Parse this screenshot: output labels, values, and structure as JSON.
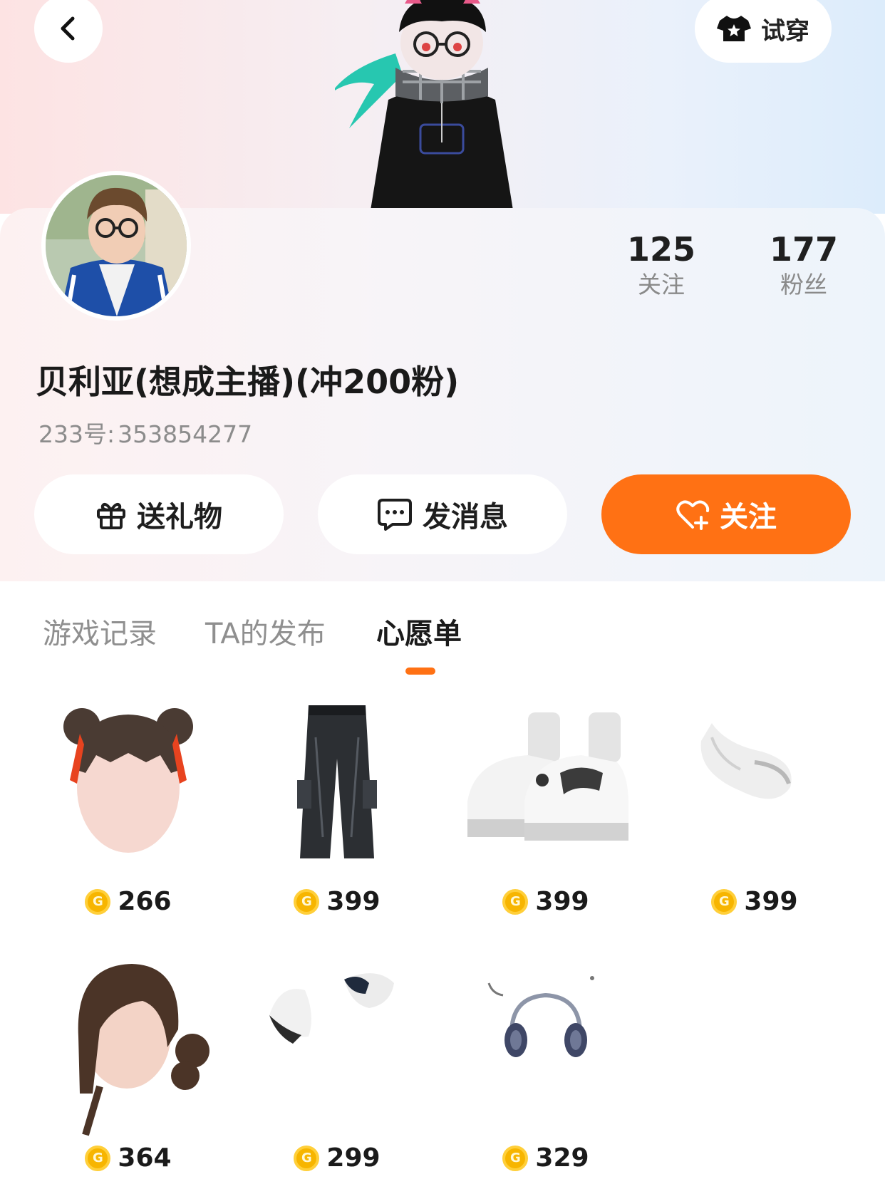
{
  "header": {
    "tryon_label": "试穿"
  },
  "profile": {
    "following_count": "125",
    "following_label": "关注",
    "followers_count": "177",
    "followers_label": "粉丝",
    "nickname": "贝利亚(想成主播)(冲200粉)",
    "uid_label": "233号:",
    "uid_value": "353854277"
  },
  "actions": {
    "gift_label": "送礼物",
    "message_label": "发消息",
    "follow_label": "关注"
  },
  "tabs": [
    {
      "label": "游戏记录"
    },
    {
      "label": "TA的发布"
    },
    {
      "label": "心愿单"
    }
  ],
  "active_tab": "心愿单",
  "wishlist": [
    {
      "kind": "hair-buns",
      "price": "266"
    },
    {
      "kind": "cargo-jeans",
      "price": "399"
    },
    {
      "kind": "sneakers",
      "price": "399"
    },
    {
      "kind": "fur-tail",
      "price": "399"
    },
    {
      "kind": "hair-low-bun",
      "price": "364"
    },
    {
      "kind": "ear-accessory",
      "price": "299"
    },
    {
      "kind": "headphones",
      "price": "329"
    }
  ],
  "colors": {
    "accent": "#ff7114",
    "coin": "#f7b500"
  }
}
